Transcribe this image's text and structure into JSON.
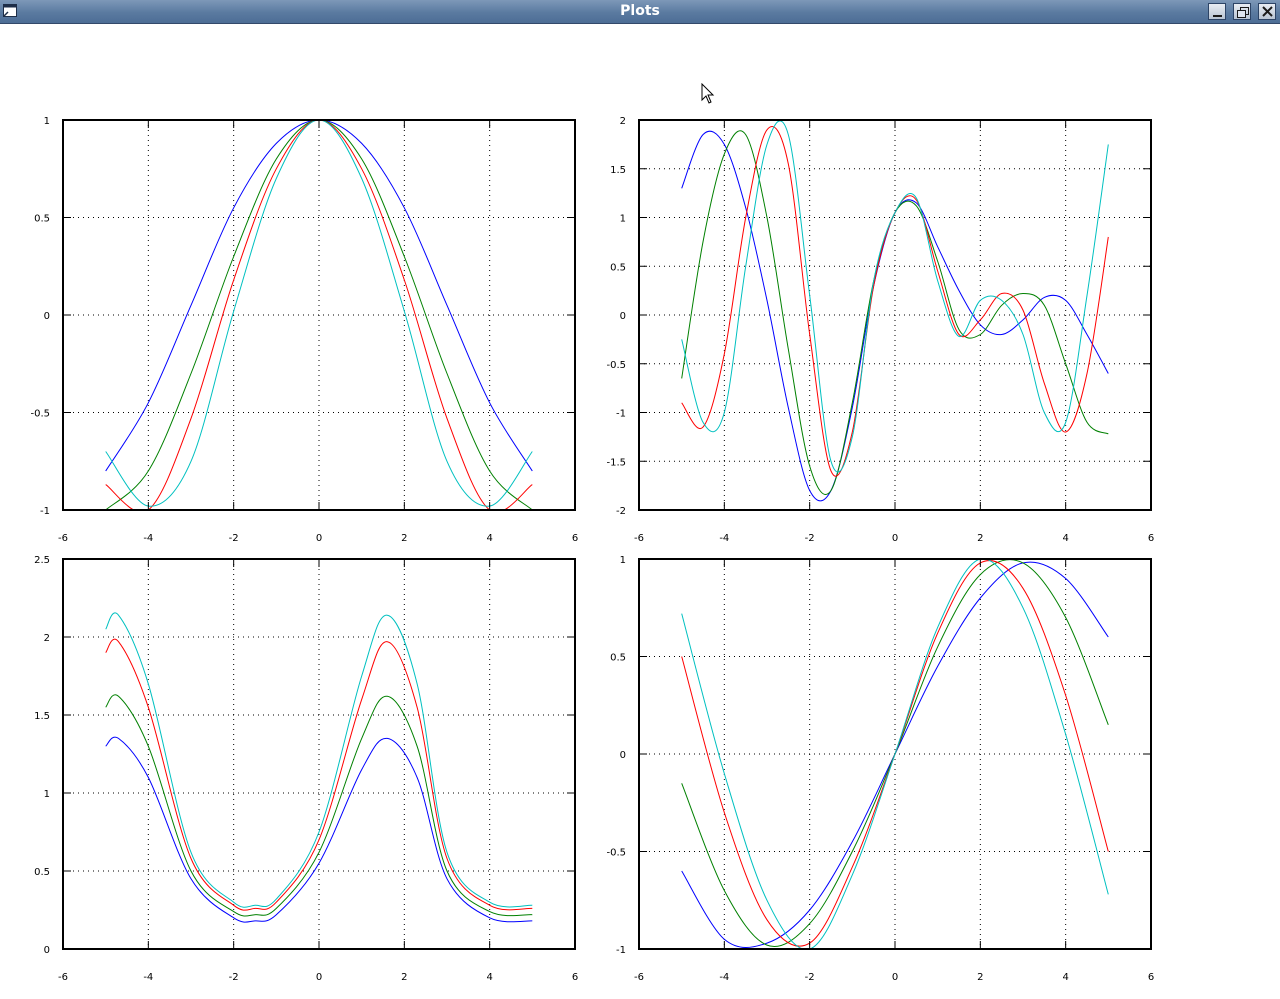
{
  "window": {
    "title": "Plots",
    "icons": [
      "window-menu-icon",
      "minimize-icon",
      "restore-icon",
      "close-icon"
    ]
  },
  "series_colors": [
    "#0000ff",
    "#008000",
    "#ff0000",
    "#00c0c0"
  ],
  "chart_data": [
    {
      "type": "line",
      "xlim": [
        -6,
        6
      ],
      "ylim": [
        -1,
        1
      ],
      "xticks": [
        "-6",
        "-4",
        "-2",
        "0",
        "2",
        "4",
        "6"
      ],
      "yticks": [
        "-1",
        "-0.5",
        "0",
        "0.5",
        "1"
      ],
      "grid": true,
      "series": [
        {
          "x": [
            -5,
            -4,
            -3,
            -2,
            -1,
            0,
            1,
            2,
            3,
            4,
            5
          ],
          "y": [
            -0.8,
            -0.45,
            0.05,
            0.55,
            0.88,
            1,
            0.88,
            0.55,
            0.05,
            -0.45,
            -0.8
          ]
        },
        {
          "x": [
            -5,
            -4,
            -3,
            -2,
            -1,
            0,
            1,
            2,
            3,
            4,
            5
          ],
          "y": [
            -1,
            -0.8,
            -0.3,
            0.3,
            0.8,
            1,
            0.8,
            0.3,
            -0.3,
            -0.8,
            -1
          ]
        },
        {
          "x": [
            -5,
            -4,
            -3,
            -2,
            -1,
            0,
            1,
            2,
            3,
            4,
            5
          ],
          "y": [
            -0.87,
            -1,
            -0.53,
            0.18,
            0.75,
            1,
            0.75,
            0.18,
            -0.53,
            -1,
            -0.87
          ]
        },
        {
          "x": [
            -5,
            -4,
            -3,
            -2,
            -1,
            0,
            1,
            2,
            3,
            4,
            5
          ],
          "y": [
            -0.7,
            -0.98,
            -0.75,
            0.02,
            0.7,
            1,
            0.7,
            0.02,
            -0.75,
            -0.98,
            -0.7
          ]
        }
      ]
    },
    {
      "type": "line",
      "xlim": [
        -6,
        6
      ],
      "ylim": [
        -2,
        2
      ],
      "xticks": [
        "-6",
        "-4",
        "-2",
        "0",
        "2",
        "4",
        "6"
      ],
      "yticks": [
        "-2",
        "-1.5",
        "-1",
        "-0.5",
        "0",
        "0.5",
        "1",
        "1.5",
        "2"
      ],
      "grid": true,
      "series": [
        {
          "x": [
            -5,
            -4.5,
            -4,
            -3.5,
            -3,
            -2.5,
            -2,
            -1.5,
            -1,
            -0.5,
            0,
            0.5,
            1,
            1.5,
            2,
            2.5,
            3,
            3.5,
            4,
            4.5,
            5
          ],
          "y": [
            1.3,
            1.85,
            1.75,
            1.1,
            0.15,
            -0.95,
            -1.8,
            -1.8,
            -0.95,
            0.3,
            1.05,
            1.15,
            0.7,
            0.25,
            -0.1,
            -0.2,
            -0.05,
            0.18,
            0.15,
            -0.2,
            -0.6
          ]
        },
        {
          "x": [
            -5,
            -4.5,
            -4,
            -3.5,
            -3,
            -2.5,
            -2,
            -1.5,
            -1,
            -0.5,
            0,
            0.5,
            1,
            1.5,
            2,
            2.5,
            3,
            3.5,
            4,
            4.5,
            5
          ],
          "y": [
            -0.65,
            0.75,
            1.65,
            1.85,
            1.0,
            -0.35,
            -1.55,
            -1.8,
            -0.9,
            0.35,
            1.05,
            1.12,
            0.55,
            -0.15,
            -0.2,
            0.1,
            0.22,
            0.1,
            -0.5,
            -1.1,
            -1.22
          ]
        },
        {
          "x": [
            -5,
            -4.5,
            -4,
            -3.5,
            -3,
            -2.5,
            -2,
            -1.5,
            -1,
            -0.5,
            0,
            0.5,
            1,
            1.5,
            2,
            2.5,
            3,
            3.5,
            4,
            4.5,
            5
          ],
          "y": [
            -0.9,
            -1.15,
            -0.4,
            1.0,
            1.9,
            1.55,
            -0.2,
            -1.6,
            -1.2,
            0.3,
            1.05,
            1.18,
            0.45,
            -0.2,
            -0.05,
            0.22,
            0.05,
            -0.7,
            -1.2,
            -0.6,
            0.8
          ]
        },
        {
          "x": [
            -5,
            -4.5,
            -4,
            -3.5,
            -3,
            -2.5,
            -2,
            -1.5,
            -1,
            -0.5,
            0,
            0.5,
            1,
            1.5,
            2,
            2.5,
            3,
            3.5,
            4,
            4.5,
            5
          ],
          "y": [
            -0.25,
            -1.1,
            -1.0,
            0.5,
            1.75,
            1.85,
            0.2,
            -1.5,
            -1.25,
            0.35,
            1.05,
            1.2,
            0.35,
            -0.22,
            0.15,
            0.15,
            -0.2,
            -1.0,
            -1.1,
            0.2,
            1.75
          ]
        }
      ]
    },
    {
      "type": "line",
      "xlim": [
        -6,
        6
      ],
      "ylim": [
        0,
        2.5
      ],
      "xticks": [
        "-6",
        "-4",
        "-2",
        "0",
        "2",
        "4",
        "6"
      ],
      "yticks": [
        "0",
        "0.5",
        "1",
        "1.5",
        "2",
        "2.5"
      ],
      "grid": true,
      "series": [
        {
          "x": [
            -5,
            -4.7,
            -4,
            -3,
            -2,
            -1.5,
            -1,
            0,
            1,
            1.6,
            2.3,
            3,
            4,
            5
          ],
          "y": [
            1.3,
            1.35,
            1.1,
            0.45,
            0.2,
            0.18,
            0.22,
            0.55,
            1.15,
            1.35,
            1.1,
            0.45,
            0.2,
            0.18
          ]
        },
        {
          "x": [
            -5,
            -4.7,
            -4,
            -3,
            -2,
            -1.5,
            -1,
            0,
            1,
            1.6,
            2.3,
            3,
            4,
            5
          ],
          "y": [
            1.55,
            1.62,
            1.3,
            0.5,
            0.24,
            0.22,
            0.26,
            0.62,
            1.35,
            1.62,
            1.3,
            0.5,
            0.24,
            0.22
          ]
        },
        {
          "x": [
            -5,
            -4.7,
            -4,
            -3,
            -2,
            -1.5,
            -1,
            0,
            1,
            1.6,
            2.3,
            3,
            4,
            5
          ],
          "y": [
            1.9,
            1.97,
            1.55,
            0.58,
            0.28,
            0.26,
            0.3,
            0.7,
            1.6,
            1.97,
            1.55,
            0.58,
            0.28,
            0.26
          ]
        },
        {
          "x": [
            -5,
            -4.7,
            -4,
            -3,
            -2,
            -1.5,
            -1,
            0,
            1,
            1.6,
            2.3,
            3,
            4,
            5
          ],
          "y": [
            2.05,
            2.14,
            1.7,
            0.62,
            0.3,
            0.28,
            0.32,
            0.75,
            1.75,
            2.14,
            1.7,
            0.62,
            0.3,
            0.28
          ]
        }
      ]
    },
    {
      "type": "line",
      "xlim": [
        -6,
        6
      ],
      "ylim": [
        -1,
        1
      ],
      "xticks": [
        "-6",
        "-4",
        "-2",
        "0",
        "2",
        "4",
        "6"
      ],
      "yticks": [
        "-1",
        "-0.5",
        "0",
        "0.5",
        "1"
      ],
      "grid": true,
      "series": [
        {
          "x": [
            -5,
            -4,
            -3,
            -2,
            -1,
            0,
            1,
            2,
            3,
            4,
            5
          ],
          "y": [
            -0.6,
            -0.95,
            -0.97,
            -0.8,
            -0.45,
            0,
            0.45,
            0.8,
            0.98,
            0.9,
            0.6
          ]
        },
        {
          "x": [
            -5,
            -4,
            -3,
            -2,
            -1,
            0,
            1,
            2,
            3,
            4,
            5
          ],
          "y": [
            -0.15,
            -0.7,
            -0.98,
            -0.87,
            -0.5,
            0,
            0.55,
            0.92,
            0.98,
            0.7,
            0.15
          ]
        },
        {
          "x": [
            -5,
            -4,
            -3,
            -2,
            -1,
            0,
            1,
            2,
            3,
            4,
            5
          ],
          "y": [
            0.5,
            -0.3,
            -0.85,
            -0.97,
            -0.58,
            0,
            0.62,
            0.98,
            0.85,
            0.3,
            -0.5
          ]
        },
        {
          "x": [
            -5,
            -4,
            -3,
            -2,
            -1,
            0,
            1,
            2,
            3,
            4,
            5
          ],
          "y": [
            0.72,
            -0.1,
            -0.75,
            -1.0,
            -0.62,
            0,
            0.65,
            1.0,
            0.75,
            0.1,
            -0.72
          ]
        }
      ]
    }
  ]
}
